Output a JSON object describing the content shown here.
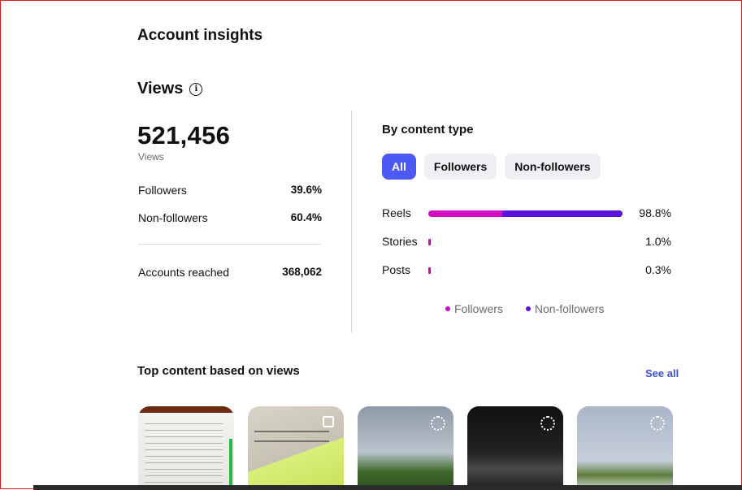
{
  "page_title": "Account insights",
  "views": {
    "heading": "Views",
    "total": "521,456",
    "total_label": "Views",
    "rows": [
      {
        "label": "Followers",
        "value": "39.6%"
      },
      {
        "label": "Non-followers",
        "value": "60.4%"
      }
    ],
    "reached_label": "Accounts reached",
    "reached_value": "368,062"
  },
  "content_type": {
    "heading": "By content type",
    "filters": [
      "All",
      "Followers",
      "Non-followers"
    ],
    "active_filter": "All",
    "rows": [
      {
        "label": "Reels",
        "percent": "98.8%",
        "share": 0.988,
        "followers_fraction": 0.38
      },
      {
        "label": "Stories",
        "percent": "1.0%",
        "share": 0.01,
        "followers_fraction": 0.5
      },
      {
        "label": "Posts",
        "percent": "0.3%",
        "share": 0.003,
        "followers_fraction": 0.5
      }
    ],
    "legend": [
      "Followers",
      "Non-followers"
    ],
    "colors": {
      "followers": "#d20cc4",
      "non_followers": "#5a12dd",
      "accent": "#4c59f5"
    }
  },
  "top_content": {
    "heading": "Top content based on views",
    "see_all": "See all"
  }
}
